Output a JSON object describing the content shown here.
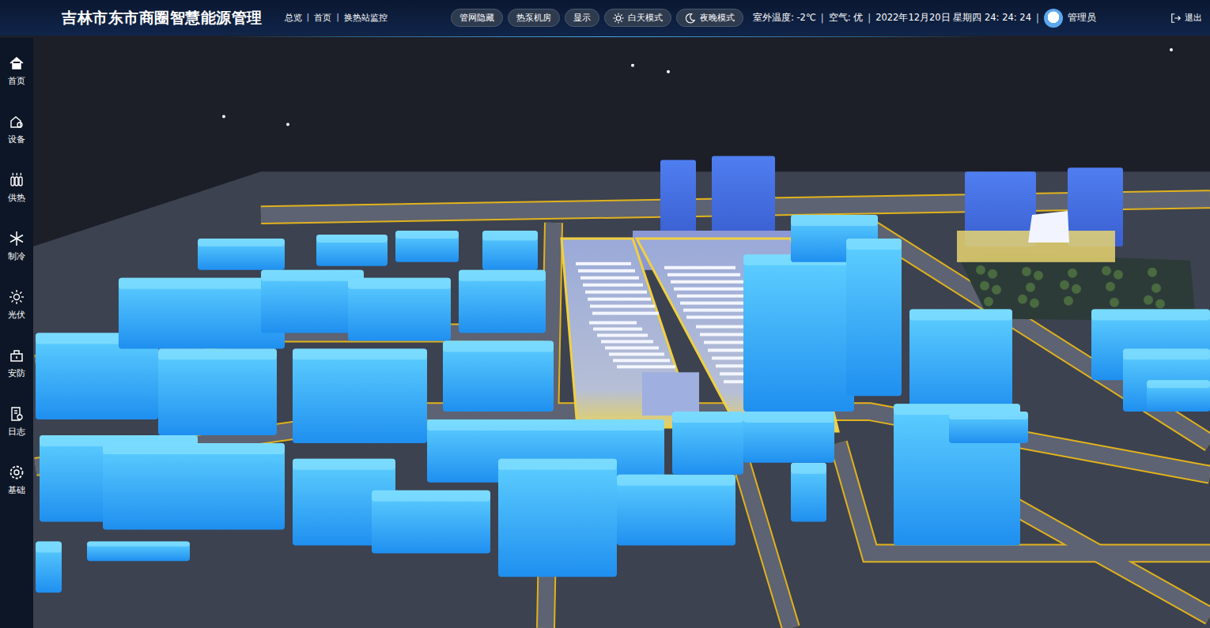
{
  "header": {
    "title": "吉林市东市商圈智慧能源管理",
    "breadcrumb": [
      "总览",
      "首页",
      "换热站监控"
    ],
    "separator": "|",
    "buttons": [
      {
        "label": "管网隐藏",
        "kind": "plain"
      },
      {
        "label": "热泵机房",
        "kind": "plain"
      },
      {
        "label": "显示",
        "kind": "plain"
      },
      {
        "label": "白天模式",
        "kind": "sun"
      },
      {
        "label": "夜晚模式",
        "kind": "moon"
      }
    ],
    "info": [
      "室外温度: -2℃",
      "空气: 优",
      "2022年12月20日 星期四 24: 24: 24"
    ],
    "user": "管理员",
    "logout": "退出"
  },
  "sidebar": {
    "items": [
      {
        "label": "首页",
        "kind": "home"
      },
      {
        "label": "设备",
        "kind": "device"
      },
      {
        "label": "供热",
        "kind": "heat"
      },
      {
        "label": "制冷",
        "kind": "cool"
      },
      {
        "label": "光伏",
        "kind": "solar"
      },
      {
        "label": "安防",
        "kind": "security"
      },
      {
        "label": "日志",
        "kind": "log"
      },
      {
        "label": "基础",
        "kind": "gear"
      }
    ]
  }
}
